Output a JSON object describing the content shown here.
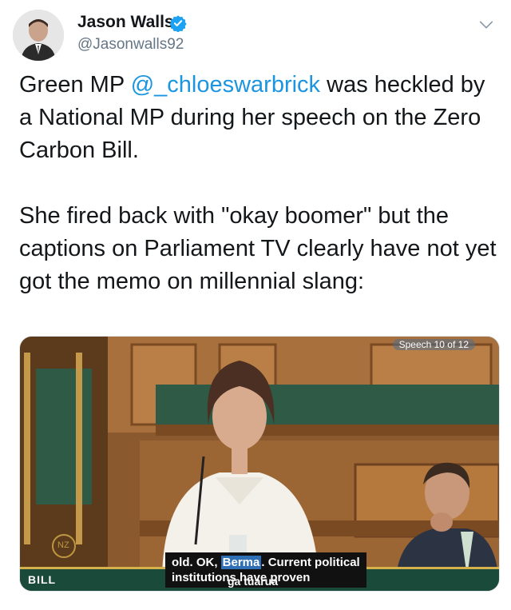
{
  "user": {
    "display_name": "Jason Walls",
    "handle": "@Jasonwalls92",
    "verified": true
  },
  "tweet": {
    "line1_before": "Green MP ",
    "mention": "@_chloeswarbrick",
    "line1_after": " was heckled by a National MP during her speech on the Zero Carbon Bill.",
    "paragraph2": "She fired back with \"okay boomer\" but the captions on Parliament TV clearly have not yet got the memo on millennial slang:"
  },
  "media": {
    "speech_label": "Speech 10 of 12",
    "caption_part1": "old. OK, ",
    "caption_highlight": "Berma",
    "caption_part2": ". Current political",
    "caption_line2": "institutions have proven",
    "bill_label": "BILL",
    "ticker": "ga tuarua",
    "watermark": "NZ"
  },
  "colors": {
    "link": "#1b95e0",
    "verified_badge": "#1da1f2",
    "secondary_text": "#657786",
    "wood": "#a8703c",
    "seat_green": "#2f5a46"
  }
}
